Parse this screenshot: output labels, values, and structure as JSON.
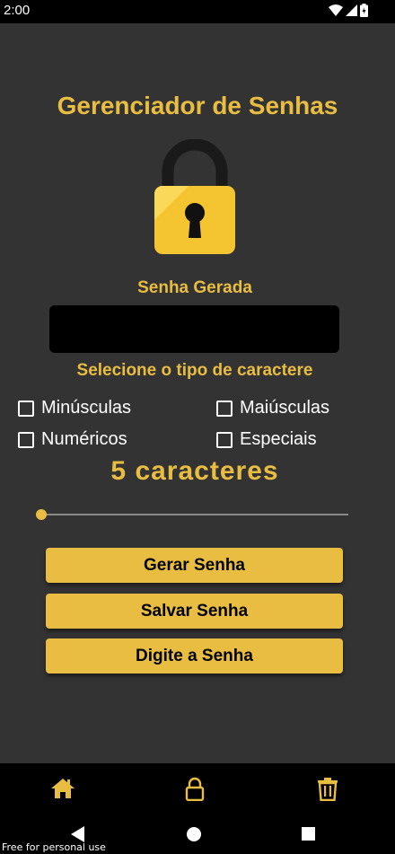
{
  "status_bar": {
    "time": "2:00"
  },
  "app": {
    "title": "Gerenciador de Senhas",
    "generated_label": "Senha Gerada",
    "generated_password": "",
    "select_label": "Selecione o tipo de caractere",
    "options": [
      {
        "label": "Minúsculas",
        "checked": false
      },
      {
        "label": "Maiúsculas",
        "checked": false
      },
      {
        "label": "Numéricos",
        "checked": false
      },
      {
        "label": "Especiais",
        "checked": false
      }
    ],
    "length_label": "5 caracteres",
    "slider": {
      "value": 5,
      "position_fraction": 0
    },
    "buttons": {
      "generate": "Gerar Senha",
      "save": "Salvar Senha",
      "type": "Digite a Senha"
    }
  },
  "bottom_nav": [
    "home-icon",
    "lock-icon",
    "trash-icon"
  ],
  "watermark": "Free for personal use",
  "colors": {
    "accent": "#e8bd41",
    "background": "#333333",
    "nav": "#000000"
  }
}
